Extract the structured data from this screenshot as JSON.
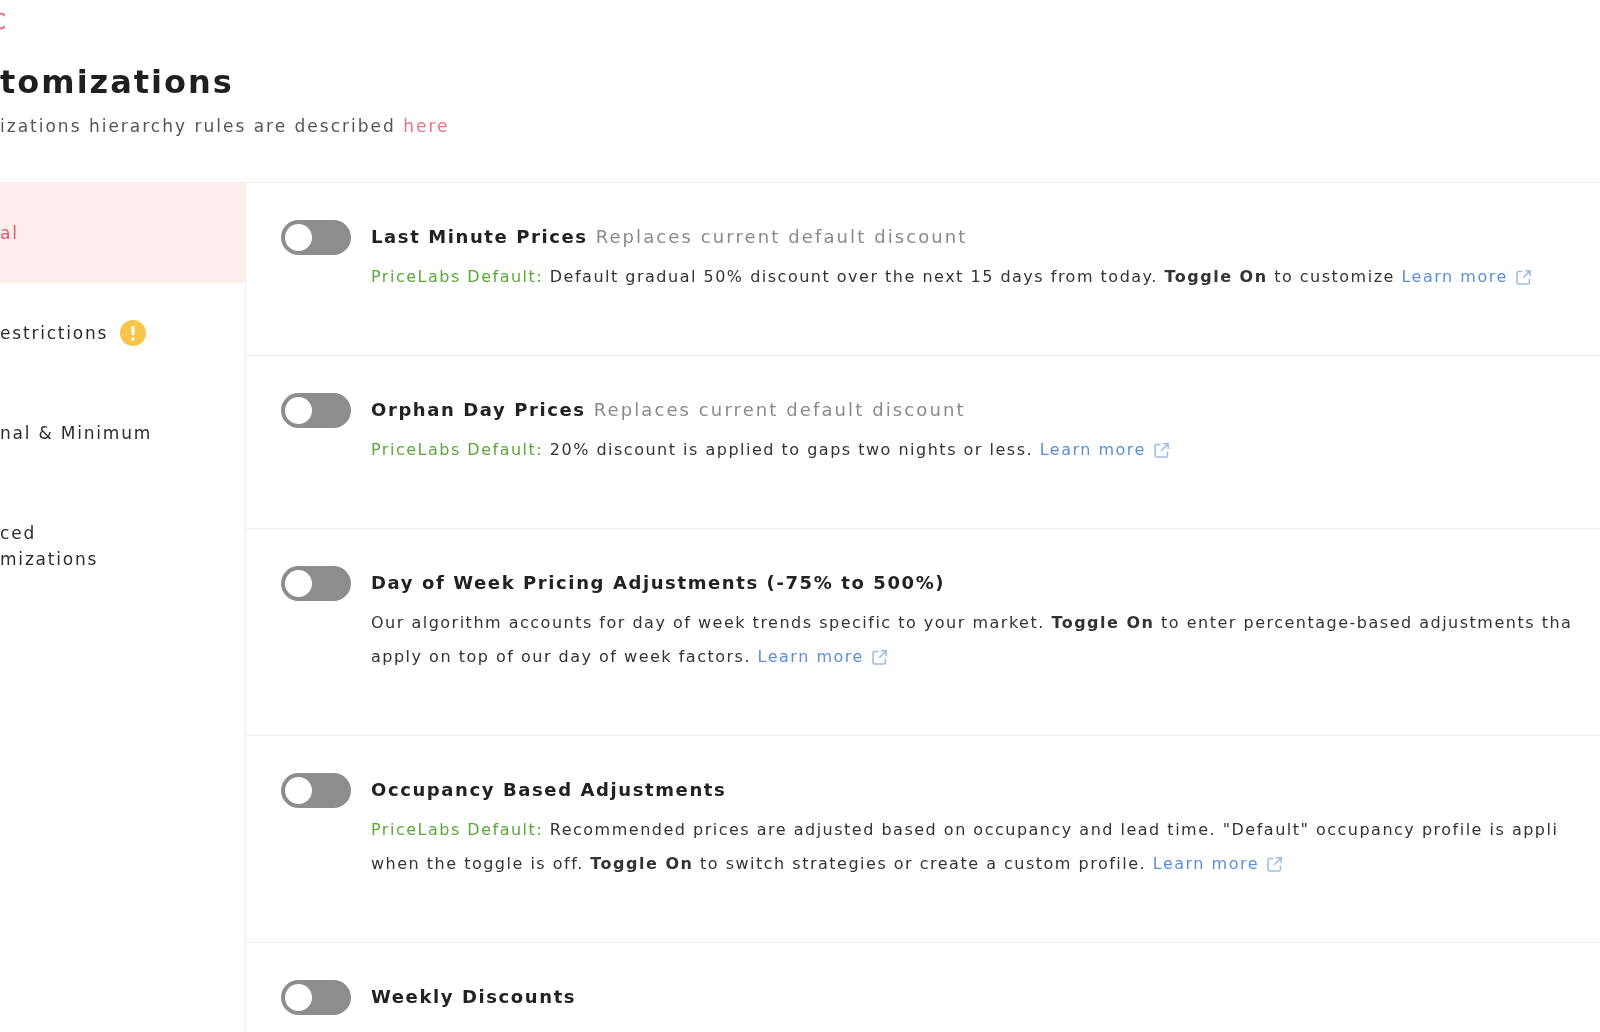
{
  "header": {
    "title": "tomizations",
    "subtitle": "izations hierarchy rules are described",
    "link": "here"
  },
  "sidebar": {
    "items": [
      {
        "lines": [
          "al"
        ],
        "selected": true,
        "warning": false
      },
      {
        "lines": [
          "estrictions"
        ],
        "selected": false,
        "warning": true
      },
      {
        "lines": [
          "nal & Minimum"
        ],
        "selected": false,
        "warning": false
      },
      {
        "lines": [
          "ced",
          "mizations"
        ],
        "selected": false,
        "warning": false
      }
    ]
  },
  "settings": [
    {
      "title": "Last Minute Prices",
      "note": "Replaces current default discount",
      "on": false,
      "default_label": "PriceLabs Default:",
      "lines": [
        "Default gradual 50% discount over the next 15 days from today. **Toggle On** to customize"
      ],
      "link": "Learn more"
    },
    {
      "title": "Orphan Day Prices",
      "note": "Replaces current default discount",
      "on": false,
      "default_label": "PriceLabs Default:",
      "lines": [
        "20% discount is applied to gaps two nights or less."
      ],
      "link": "Learn more"
    },
    {
      "title": "Day of Week Pricing Adjustments (-75% to 500%)",
      "on": false,
      "lines": [
        "Our algorithm accounts for day of week trends specific to your market. **Toggle On** to enter percentage-based adjustments tha",
        "apply on top of our day of week factors."
      ],
      "link": "Learn more"
    },
    {
      "title": "Occupancy Based Adjustments",
      "on": false,
      "default_label": "PriceLabs Default:",
      "lines": [
        "Recommended prices are adjusted based on occupancy and lead time. \"Default\" occupancy profile is appli",
        "when the toggle is off. **Toggle On** to switch strategies or create a custom profile."
      ],
      "link": "Learn more"
    },
    {
      "title": "Weekly Discounts",
      "on": false
    }
  ]
}
